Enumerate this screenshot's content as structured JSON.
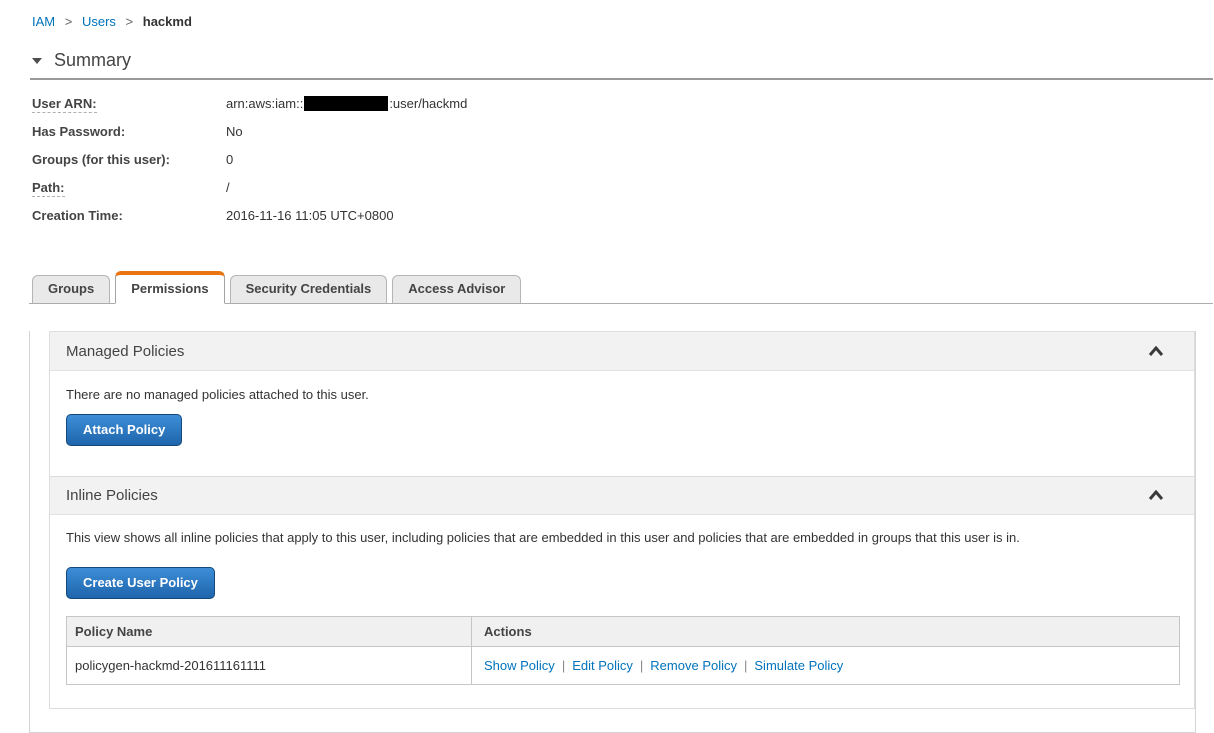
{
  "breadcrumb": {
    "separator": ">",
    "items": [
      {
        "label": "IAM"
      },
      {
        "label": "Users"
      },
      {
        "label": "hackmd"
      }
    ]
  },
  "summary": {
    "title": "Summary",
    "arn": {
      "prefix": "arn:aws:iam::",
      "suffix": ":user/hackmd",
      "redacted": "account-id-hidden"
    },
    "fields": [
      {
        "label": "User ARN:"
      },
      {
        "label": "Has Password:",
        "value": "No"
      },
      {
        "label": "Groups (for this user):",
        "value": "0"
      },
      {
        "label": "Path:",
        "value": "/"
      },
      {
        "label": "Creation Time:",
        "value": "2016-11-16 11:05 UTC+0800"
      }
    ]
  },
  "tabs": [
    {
      "label": "Groups",
      "active": false
    },
    {
      "label": "Permissions",
      "active": true
    },
    {
      "label": "Security Credentials",
      "active": false
    },
    {
      "label": "Access Advisor",
      "active": false
    }
  ],
  "managed_policies": {
    "title": "Managed Policies",
    "empty_text": "There are no managed policies attached to this user.",
    "attach_button": "Attach Policy",
    "collapse_icon": "chevron-up"
  },
  "inline_policies": {
    "title": "Inline Policies",
    "description": "This view shows all inline policies that apply to this user, including policies that are embedded in this user and policies that are embedded in groups that this user is in.",
    "create_button": "Create User Policy",
    "collapse_icon": "chevron-up",
    "table": {
      "headers": [
        "Policy Name",
        "Actions"
      ],
      "actions_separator": "|",
      "rows": [
        {
          "policy_name": "policygen-hackmd-201611161111",
          "actions": [
            "Show Policy",
            "Edit Policy",
            "Remove Policy",
            "Simulate Policy"
          ]
        }
      ]
    }
  },
  "colors": {
    "accent_orange": "#e87511",
    "link_blue": "#0073bb",
    "button_blue_top": "#3d8ed7",
    "button_blue_bottom": "#1f65ac"
  }
}
